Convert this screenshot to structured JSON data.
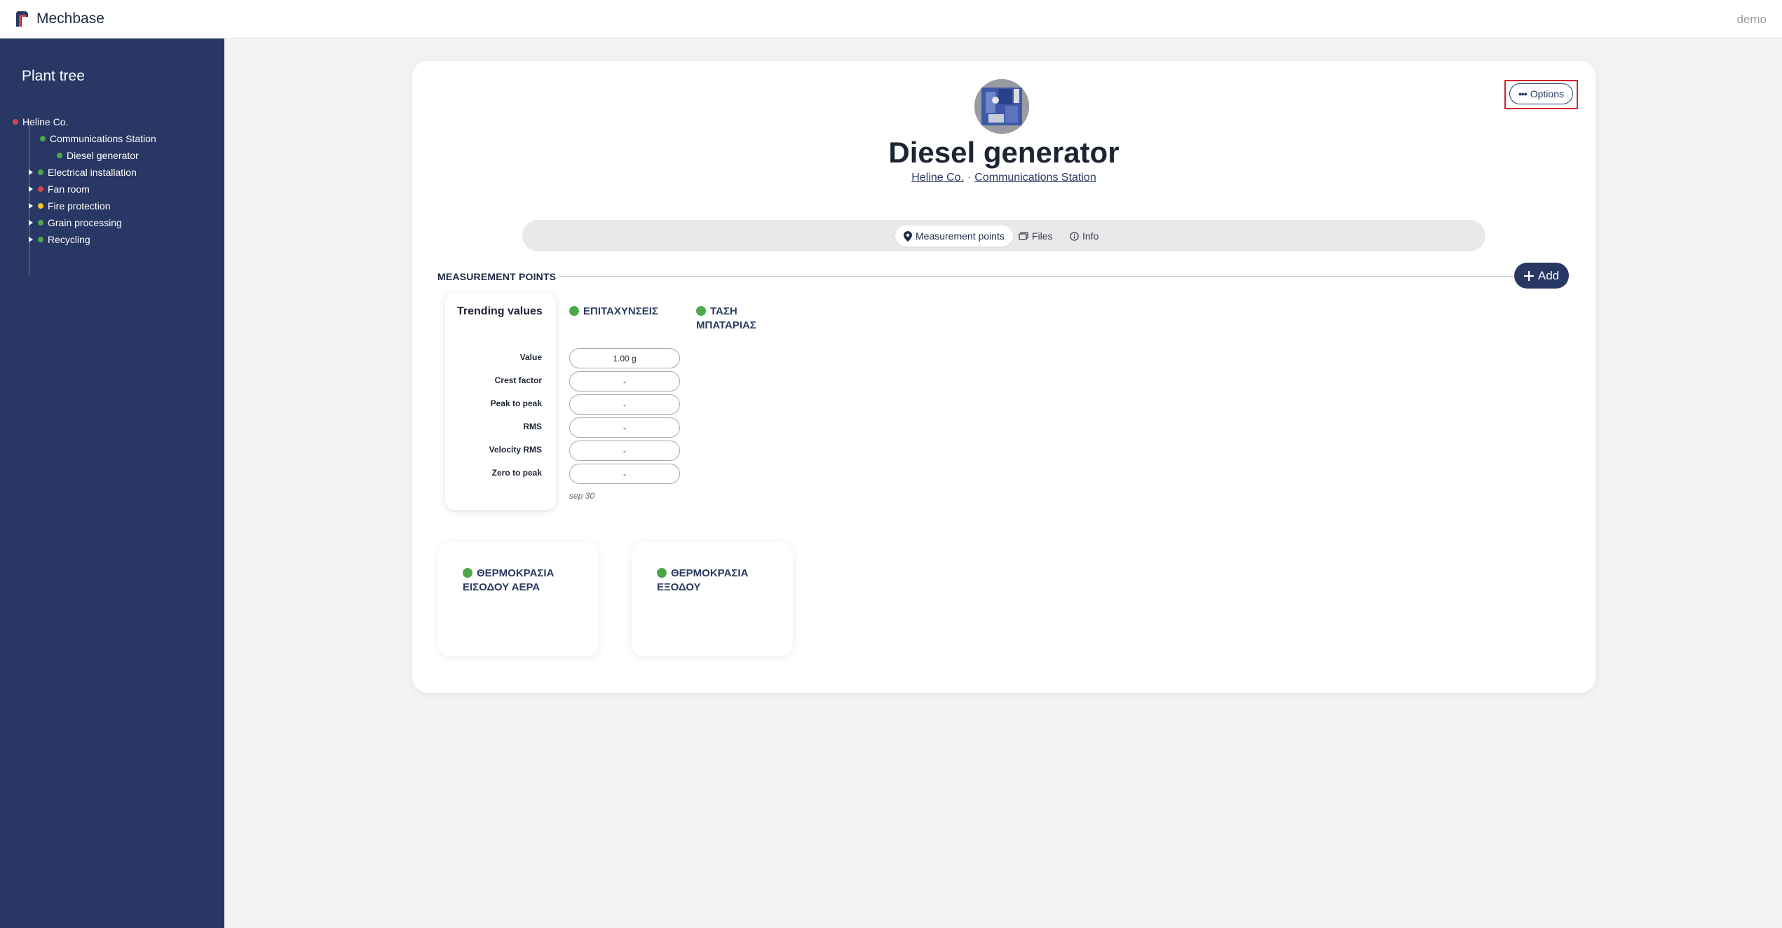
{
  "app": {
    "title": "Mechbase",
    "user": "demo"
  },
  "sidebar": {
    "title": "Plant tree",
    "items": [
      {
        "label": "Heline Co.",
        "status_color": "#d9434f",
        "caret": "none"
      },
      {
        "label": "Communications Station",
        "status_color": "#4ea84a",
        "caret": "none"
      },
      {
        "label": "Diesel generator",
        "status_color": "#4ea84a",
        "caret": "none"
      },
      {
        "label": "Electrical installation",
        "status_color": "#4ea84a",
        "caret": "right"
      },
      {
        "label": "Fan room",
        "status_color": "#d9434f",
        "caret": "right"
      },
      {
        "label": "Fire protection",
        "status_color": "#f1c232",
        "caret": "right"
      },
      {
        "label": "Grain processing",
        "status_color": "#4ea84a",
        "caret": "right"
      },
      {
        "label": "Recycling",
        "status_color": "#4ea84a",
        "caret": "right"
      }
    ]
  },
  "asset": {
    "title": "Diesel generator",
    "breadcrumb": [
      "Heline Co.",
      "Communications Station"
    ],
    "breadcrumb_sep": "·",
    "options_label": "Options"
  },
  "tabs": [
    {
      "label": "Measurement points",
      "icon": "map-pin-icon",
      "active": true
    },
    {
      "label": "Files",
      "icon": "files-icon",
      "active": false
    },
    {
      "label": "Info",
      "icon": "info-icon",
      "active": false
    }
  ],
  "section": {
    "title": "MEASUREMENT POINTS",
    "add_label": "Add"
  },
  "trending": {
    "title": "Trending values",
    "metrics": [
      "Value",
      "Crest factor",
      "Peak to peak",
      "RMS",
      "Velocity RMS",
      "Zero to peak"
    ]
  },
  "measurement_points": [
    {
      "name": "ΕΠΙΤΑΧΥΝΣΕΙΣ",
      "status_color": "#4ea84a",
      "values": [
        "1.00 g",
        "-",
        "-",
        "-",
        "-",
        "-"
      ],
      "date": "sep 30"
    },
    {
      "name": "ΤΑΣΗ ΜΠΑΤΑΡΙΑΣ",
      "status_color": "#4ea84a"
    }
  ],
  "other_points": [
    {
      "name": "ΘΕΡΜΟΚΡΑΣΙΑ ΕΙΣΟΔΟΥ ΑΕΡΑ",
      "status_color": "#4ea84a"
    },
    {
      "name": "ΘΕΡΜΟΚΡΑΣΙΑ ΕΞΟΔΟΥ",
      "status_color": "#4ea84a"
    }
  ]
}
